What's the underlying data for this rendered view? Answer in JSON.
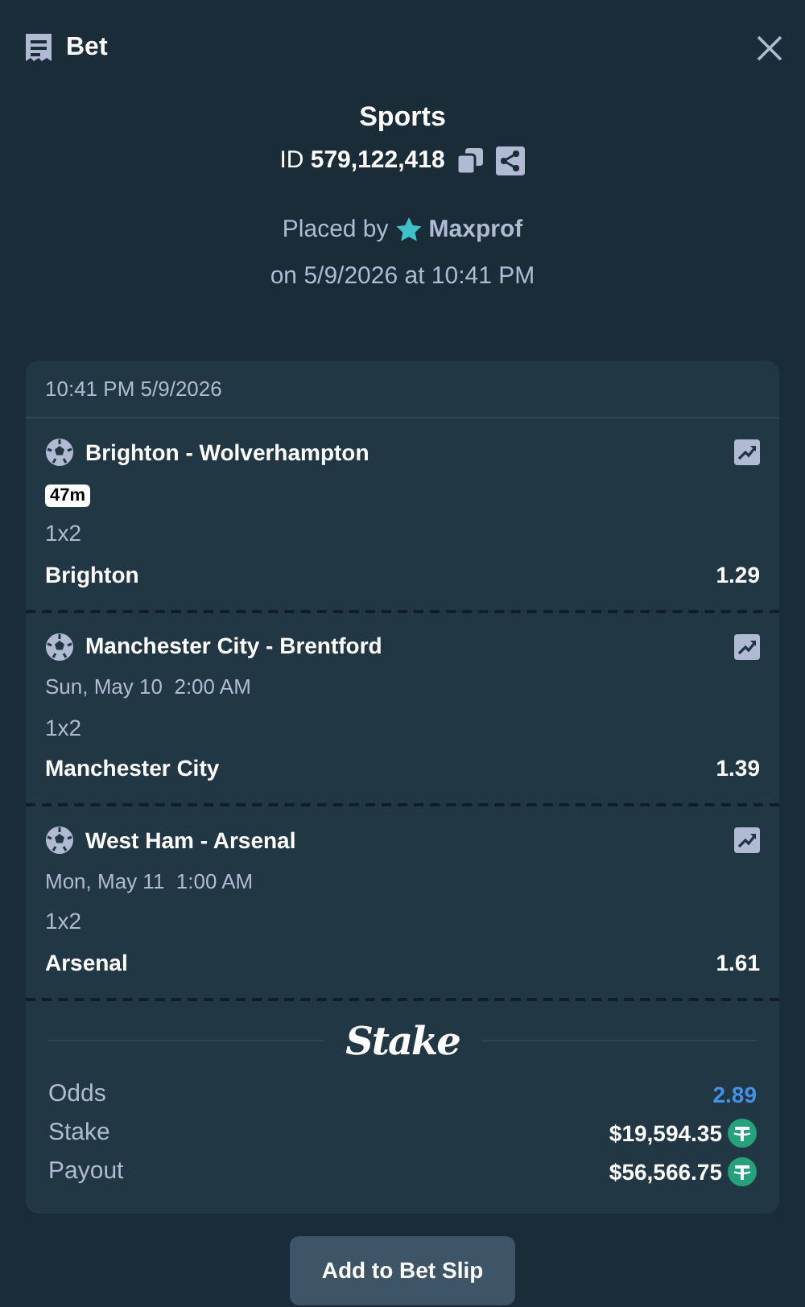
{
  "header": {
    "title": "Bet"
  },
  "bet": {
    "category": "Sports",
    "id_label": "ID",
    "id_value": "579,122,418",
    "placed_by_label": "Placed by",
    "user": "Maxprof",
    "placed_on": "on 5/9/2026 at 10:41 PM"
  },
  "slip": {
    "timestamp": "10:41 PM 5/9/2026",
    "legs": [
      {
        "match": "Brighton - Wolverhampton",
        "live_badge": "47m",
        "market": "1x2",
        "selection": "Brighton",
        "odds": "1.29"
      },
      {
        "match": "Manchester City - Brentford",
        "start_time": "Sun, May 10  2:00 AM",
        "market": "1x2",
        "selection": "Manchester City",
        "odds": "1.39"
      },
      {
        "match": "West Ham - Arsenal",
        "start_time": "Mon, May 11  1:00 AM",
        "market": "1x2",
        "selection": "Arsenal",
        "odds": "1.61"
      }
    ],
    "brand": "Stake",
    "summary": [
      {
        "kind": "odds",
        "label": "Odds",
        "value": "2.89"
      },
      {
        "kind": "amount",
        "label": "Stake",
        "value": "$19,594.35"
      },
      {
        "kind": "amount",
        "label": "Payout",
        "value": "$56,566.75"
      }
    ]
  },
  "action": "Add to Bet Slip"
}
